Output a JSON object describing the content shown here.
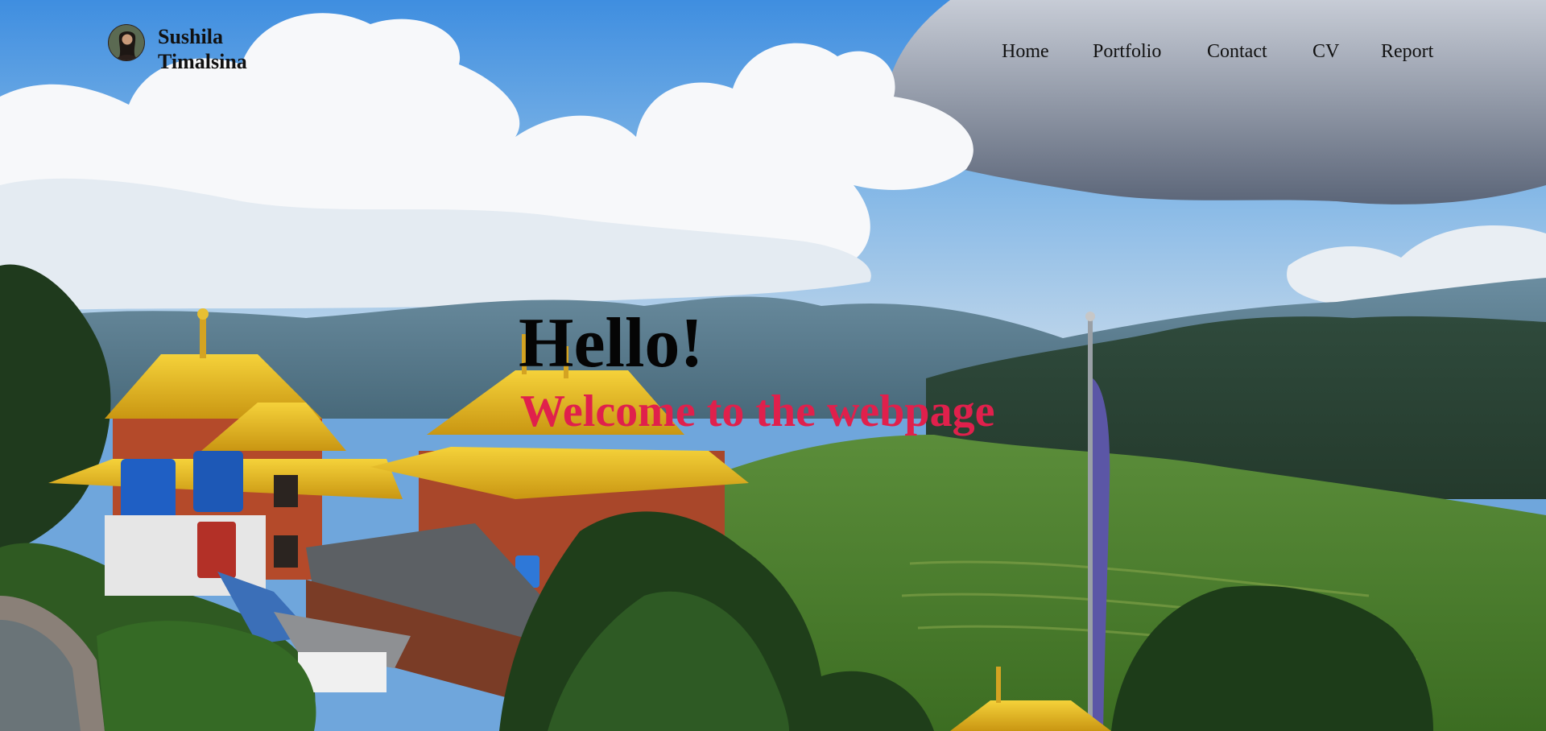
{
  "brand": {
    "name": "Sushila Timalsina"
  },
  "nav": {
    "items": [
      {
        "label": "Home"
      },
      {
        "label": "Portfolio"
      },
      {
        "label": "Contact"
      },
      {
        "label": "CV"
      },
      {
        "label": "Report"
      }
    ]
  },
  "hero": {
    "title": "Hello!",
    "subtitle": "Welcome to the webpage",
    "subtitle_color": "#e0204c",
    "background": "monastery-hills-landscape-photo"
  }
}
